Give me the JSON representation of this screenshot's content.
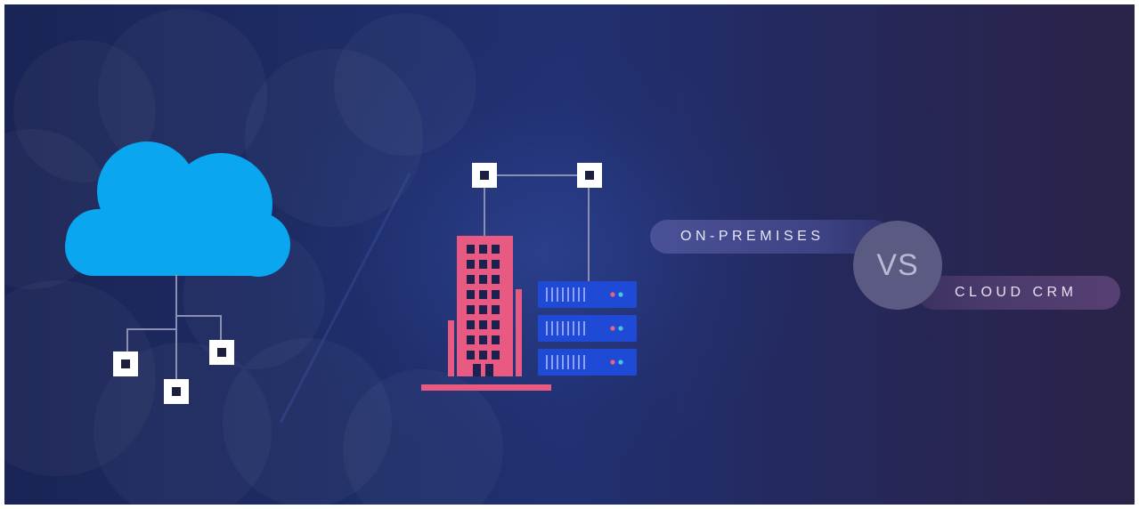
{
  "labels": {
    "on_premises": "ON-PREMISES",
    "vs": "VS",
    "cloud_crm": "CLOUD CRM"
  },
  "colors": {
    "background_left": "#1a2455",
    "background_right": "#2b2348",
    "cloud": "#0aa6f0",
    "building": "#e85a82",
    "server": "#1f4ad6",
    "server_vent": "#8fa0ff",
    "node_fill": "#ffffff",
    "node_core": "#1b1f3d",
    "connector_line": "#8a8eb0",
    "vs_circle": "#5b5a82",
    "led_red": "#f0607a",
    "led_teal": "#46c7d8"
  },
  "icons": {
    "cloud": "cloud-icon",
    "network_node": "network-node-icon",
    "office_building": "office-building-icon",
    "server_rack": "server-rack-icon"
  }
}
